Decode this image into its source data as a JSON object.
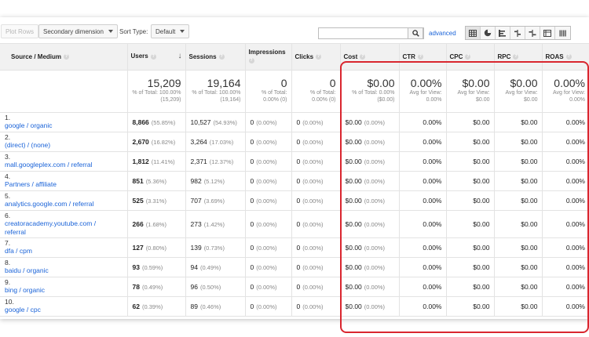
{
  "toolbar": {
    "plot_rows": "Plot Rows",
    "secondary_dimension": "Secondary dimension",
    "sort_type_label": "Sort Type:",
    "sort_type_value": "Default",
    "search_value": "",
    "advanced": "advanced",
    "views": [
      "table-view-icon",
      "pie-view-icon",
      "performance-view-icon",
      "comparison-view-icon",
      "term-cloud-view-icon",
      "pivot-view-icon"
    ]
  },
  "columns": {
    "source_medium": "Source / Medium",
    "users": "Users",
    "sessions": "Sessions",
    "impressions": "Impressions",
    "clicks": "Clicks",
    "cost": "Cost",
    "ctr": "CTR",
    "cpc": "CPC",
    "rpc": "RPC",
    "roas": "ROAS"
  },
  "totals": {
    "users": {
      "value": "15,209",
      "sub1": "% of Total: 100.00%",
      "sub2": "(15,209)"
    },
    "sessions": {
      "value": "19,164",
      "sub1": "% of Total: 100.00%",
      "sub2": "(19,164)"
    },
    "impressions": {
      "value": "0",
      "sub1": "% of Total:",
      "sub2": "0.00% (0)"
    },
    "clicks": {
      "value": "0",
      "sub1": "% of Total:",
      "sub2": "0.00% (0)"
    },
    "cost": {
      "value": "$0.00",
      "sub1": "% of Total: 0.00%",
      "sub2": "($0.00)"
    },
    "ctr": {
      "value": "0.00%",
      "sub1": "Avg for View:",
      "sub2": "0.00%"
    },
    "cpc": {
      "value": "$0.00",
      "sub1": "Avg for View:",
      "sub2": "$0.00"
    },
    "rpc": {
      "value": "$0.00",
      "sub1": "Avg for View:",
      "sub2": "$0.00"
    },
    "roas": {
      "value": "0.00%",
      "sub1": "Avg for View:",
      "sub2": "0.00%"
    }
  },
  "rows": [
    {
      "idx": "1.",
      "source": "google / organic",
      "users": "8,866",
      "users_pct": "(55.85%)",
      "sessions": "10,527",
      "sessions_pct": "(54.93%)",
      "impressions": "0",
      "impressions_pct": "(0.00%)",
      "clicks": "0",
      "clicks_pct": "(0.00%)",
      "cost": "$0.00",
      "cost_pct": "(0.00%)",
      "ctr": "0.00%",
      "cpc": "$0.00",
      "rpc": "$0.00",
      "roas": "0.00%"
    },
    {
      "idx": "2.",
      "source": "(direct) / (none)",
      "users": "2,670",
      "users_pct": "(16.82%)",
      "sessions": "3,264",
      "sessions_pct": "(17.03%)",
      "impressions": "0",
      "impressions_pct": "(0.00%)",
      "clicks": "0",
      "clicks_pct": "(0.00%)",
      "cost": "$0.00",
      "cost_pct": "(0.00%)",
      "ctr": "0.00%",
      "cpc": "$0.00",
      "rpc": "$0.00",
      "roas": "0.00%"
    },
    {
      "idx": "3.",
      "source": "mall.googleplex.com / referral",
      "users": "1,812",
      "users_pct": "(11.41%)",
      "sessions": "2,371",
      "sessions_pct": "(12.37%)",
      "impressions": "0",
      "impressions_pct": "(0.00%)",
      "clicks": "0",
      "clicks_pct": "(0.00%)",
      "cost": "$0.00",
      "cost_pct": "(0.00%)",
      "ctr": "0.00%",
      "cpc": "$0.00",
      "rpc": "$0.00",
      "roas": "0.00%"
    },
    {
      "idx": "4.",
      "source": "Partners / affiliate",
      "users": "851",
      "users_pct": "(5.36%)",
      "sessions": "982",
      "sessions_pct": "(5.12%)",
      "impressions": "0",
      "impressions_pct": "(0.00%)",
      "clicks": "0",
      "clicks_pct": "(0.00%)",
      "cost": "$0.00",
      "cost_pct": "(0.00%)",
      "ctr": "0.00%",
      "cpc": "$0.00",
      "rpc": "$0.00",
      "roas": "0.00%"
    },
    {
      "idx": "5.",
      "source": "analytics.google.com / referral",
      "users": "525",
      "users_pct": "(3.31%)",
      "sessions": "707",
      "sessions_pct": "(3.69%)",
      "impressions": "0",
      "impressions_pct": "(0.00%)",
      "clicks": "0",
      "clicks_pct": "(0.00%)",
      "cost": "$0.00",
      "cost_pct": "(0.00%)",
      "ctr": "0.00%",
      "cpc": "$0.00",
      "rpc": "$0.00",
      "roas": "0.00%"
    },
    {
      "idx": "6.",
      "source": "creatoracademy.youtube.com / referral",
      "users": "266",
      "users_pct": "(1.68%)",
      "sessions": "273",
      "sessions_pct": "(1.42%)",
      "impressions": "0",
      "impressions_pct": "(0.00%)",
      "clicks": "0",
      "clicks_pct": "(0.00%)",
      "cost": "$0.00",
      "cost_pct": "(0.00%)",
      "ctr": "0.00%",
      "cpc": "$0.00",
      "rpc": "$0.00",
      "roas": "0.00%",
      "tall": true
    },
    {
      "idx": "7.",
      "source": "dfa / cpm",
      "users": "127",
      "users_pct": "(0.80%)",
      "sessions": "139",
      "sessions_pct": "(0.73%)",
      "impressions": "0",
      "impressions_pct": "(0.00%)",
      "clicks": "0",
      "clicks_pct": "(0.00%)",
      "cost": "$0.00",
      "cost_pct": "(0.00%)",
      "ctr": "0.00%",
      "cpc": "$0.00",
      "rpc": "$0.00",
      "roas": "0.00%"
    },
    {
      "idx": "8.",
      "source": "baidu / organic",
      "users": "93",
      "users_pct": "(0.59%)",
      "sessions": "94",
      "sessions_pct": "(0.49%)",
      "impressions": "0",
      "impressions_pct": "(0.00%)",
      "clicks": "0",
      "clicks_pct": "(0.00%)",
      "cost": "$0.00",
      "cost_pct": "(0.00%)",
      "ctr": "0.00%",
      "cpc": "$0.00",
      "rpc": "$0.00",
      "roas": "0.00%"
    },
    {
      "idx": "9.",
      "source": "bing / organic",
      "users": "78",
      "users_pct": "(0.49%)",
      "sessions": "96",
      "sessions_pct": "(0.50%)",
      "impressions": "0",
      "impressions_pct": "(0.00%)",
      "clicks": "0",
      "clicks_pct": "(0.00%)",
      "cost": "$0.00",
      "cost_pct": "(0.00%)",
      "ctr": "0.00%",
      "cpc": "$0.00",
      "rpc": "$0.00",
      "roas": "0.00%"
    },
    {
      "idx": "10.",
      "source": "google / cpc",
      "users": "62",
      "users_pct": "(0.39%)",
      "sessions": "89",
      "sessions_pct": "(0.46%)",
      "impressions": "0",
      "impressions_pct": "(0.00%)",
      "clicks": "0",
      "clicks_pct": "(0.00%)",
      "cost": "$0.00",
      "cost_pct": "(0.00%)",
      "ctr": "0.00%",
      "cpc": "$0.00",
      "rpc": "$0.00",
      "roas": "0.00%"
    }
  ],
  "colors": {
    "link": "#1a63d8",
    "highlight": "#d9262f",
    "header_bg": "#f1f1f1"
  }
}
